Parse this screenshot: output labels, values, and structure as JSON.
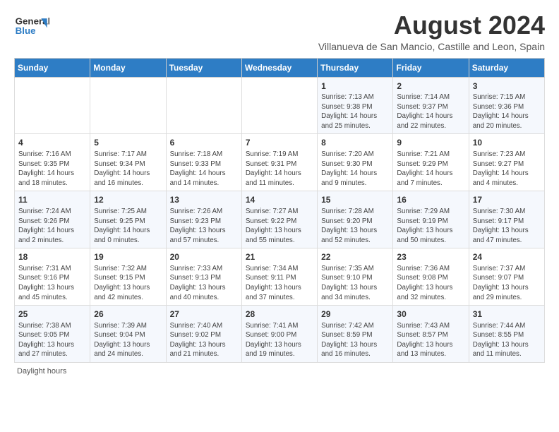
{
  "header": {
    "logo_line1": "General",
    "logo_line2": "Blue",
    "title": "August 2024",
    "subtitle": "Villanueva de San Mancio, Castille and Leon, Spain"
  },
  "days_of_week": [
    "Sunday",
    "Monday",
    "Tuesday",
    "Wednesday",
    "Thursday",
    "Friday",
    "Saturday"
  ],
  "weeks": [
    [
      {
        "day": "",
        "text": ""
      },
      {
        "day": "",
        "text": ""
      },
      {
        "day": "",
        "text": ""
      },
      {
        "day": "",
        "text": ""
      },
      {
        "day": "1",
        "text": "Sunrise: 7:13 AM\nSunset: 9:38 PM\nDaylight: 14 hours and 25 minutes."
      },
      {
        "day": "2",
        "text": "Sunrise: 7:14 AM\nSunset: 9:37 PM\nDaylight: 14 hours and 22 minutes."
      },
      {
        "day": "3",
        "text": "Sunrise: 7:15 AM\nSunset: 9:36 PM\nDaylight: 14 hours and 20 minutes."
      }
    ],
    [
      {
        "day": "4",
        "text": "Sunrise: 7:16 AM\nSunset: 9:35 PM\nDaylight: 14 hours and 18 minutes."
      },
      {
        "day": "5",
        "text": "Sunrise: 7:17 AM\nSunset: 9:34 PM\nDaylight: 14 hours and 16 minutes."
      },
      {
        "day": "6",
        "text": "Sunrise: 7:18 AM\nSunset: 9:33 PM\nDaylight: 14 hours and 14 minutes."
      },
      {
        "day": "7",
        "text": "Sunrise: 7:19 AM\nSunset: 9:31 PM\nDaylight: 14 hours and 11 minutes."
      },
      {
        "day": "8",
        "text": "Sunrise: 7:20 AM\nSunset: 9:30 PM\nDaylight: 14 hours and 9 minutes."
      },
      {
        "day": "9",
        "text": "Sunrise: 7:21 AM\nSunset: 9:29 PM\nDaylight: 14 hours and 7 minutes."
      },
      {
        "day": "10",
        "text": "Sunrise: 7:23 AM\nSunset: 9:27 PM\nDaylight: 14 hours and 4 minutes."
      }
    ],
    [
      {
        "day": "11",
        "text": "Sunrise: 7:24 AM\nSunset: 9:26 PM\nDaylight: 14 hours and 2 minutes."
      },
      {
        "day": "12",
        "text": "Sunrise: 7:25 AM\nSunset: 9:25 PM\nDaylight: 14 hours and 0 minutes."
      },
      {
        "day": "13",
        "text": "Sunrise: 7:26 AM\nSunset: 9:23 PM\nDaylight: 13 hours and 57 minutes."
      },
      {
        "day": "14",
        "text": "Sunrise: 7:27 AM\nSunset: 9:22 PM\nDaylight: 13 hours and 55 minutes."
      },
      {
        "day": "15",
        "text": "Sunrise: 7:28 AM\nSunset: 9:20 PM\nDaylight: 13 hours and 52 minutes."
      },
      {
        "day": "16",
        "text": "Sunrise: 7:29 AM\nSunset: 9:19 PM\nDaylight: 13 hours and 50 minutes."
      },
      {
        "day": "17",
        "text": "Sunrise: 7:30 AM\nSunset: 9:17 PM\nDaylight: 13 hours and 47 minutes."
      }
    ],
    [
      {
        "day": "18",
        "text": "Sunrise: 7:31 AM\nSunset: 9:16 PM\nDaylight: 13 hours and 45 minutes."
      },
      {
        "day": "19",
        "text": "Sunrise: 7:32 AM\nSunset: 9:15 PM\nDaylight: 13 hours and 42 minutes."
      },
      {
        "day": "20",
        "text": "Sunrise: 7:33 AM\nSunset: 9:13 PM\nDaylight: 13 hours and 40 minutes."
      },
      {
        "day": "21",
        "text": "Sunrise: 7:34 AM\nSunset: 9:11 PM\nDaylight: 13 hours and 37 minutes."
      },
      {
        "day": "22",
        "text": "Sunrise: 7:35 AM\nSunset: 9:10 PM\nDaylight: 13 hours and 34 minutes."
      },
      {
        "day": "23",
        "text": "Sunrise: 7:36 AM\nSunset: 9:08 PM\nDaylight: 13 hours and 32 minutes."
      },
      {
        "day": "24",
        "text": "Sunrise: 7:37 AM\nSunset: 9:07 PM\nDaylight: 13 hours and 29 minutes."
      }
    ],
    [
      {
        "day": "25",
        "text": "Sunrise: 7:38 AM\nSunset: 9:05 PM\nDaylight: 13 hours and 27 minutes."
      },
      {
        "day": "26",
        "text": "Sunrise: 7:39 AM\nSunset: 9:04 PM\nDaylight: 13 hours and 24 minutes."
      },
      {
        "day": "27",
        "text": "Sunrise: 7:40 AM\nSunset: 9:02 PM\nDaylight: 13 hours and 21 minutes."
      },
      {
        "day": "28",
        "text": "Sunrise: 7:41 AM\nSunset: 9:00 PM\nDaylight: 13 hours and 19 minutes."
      },
      {
        "day": "29",
        "text": "Sunrise: 7:42 AM\nSunset: 8:59 PM\nDaylight: 13 hours and 16 minutes."
      },
      {
        "day": "30",
        "text": "Sunrise: 7:43 AM\nSunset: 8:57 PM\nDaylight: 13 hours and 13 minutes."
      },
      {
        "day": "31",
        "text": "Sunrise: 7:44 AM\nSunset: 8:55 PM\nDaylight: 13 hours and 11 minutes."
      }
    ]
  ],
  "footer": {
    "note": "Daylight hours"
  }
}
